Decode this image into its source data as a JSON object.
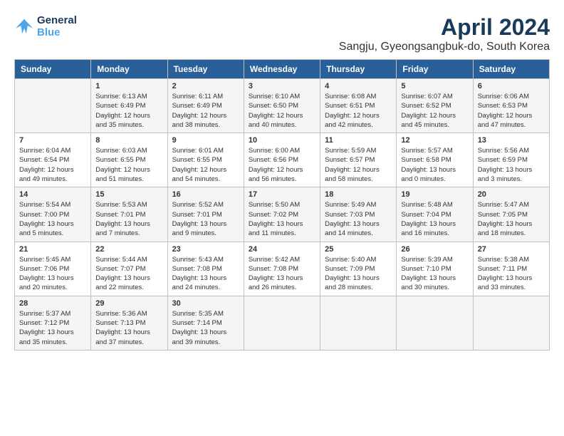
{
  "logo": {
    "line1": "General",
    "line2": "Blue"
  },
  "title": "April 2024",
  "subtitle": "Sangju, Gyeongsangbuk-do, South Korea",
  "headers": [
    "Sunday",
    "Monday",
    "Tuesday",
    "Wednesday",
    "Thursday",
    "Friday",
    "Saturday"
  ],
  "weeks": [
    [
      {
        "day": "",
        "info": ""
      },
      {
        "day": "1",
        "info": "Sunrise: 6:13 AM\nSunset: 6:49 PM\nDaylight: 12 hours\nand 35 minutes."
      },
      {
        "day": "2",
        "info": "Sunrise: 6:11 AM\nSunset: 6:49 PM\nDaylight: 12 hours\nand 38 minutes."
      },
      {
        "day": "3",
        "info": "Sunrise: 6:10 AM\nSunset: 6:50 PM\nDaylight: 12 hours\nand 40 minutes."
      },
      {
        "day": "4",
        "info": "Sunrise: 6:08 AM\nSunset: 6:51 PM\nDaylight: 12 hours\nand 42 minutes."
      },
      {
        "day": "5",
        "info": "Sunrise: 6:07 AM\nSunset: 6:52 PM\nDaylight: 12 hours\nand 45 minutes."
      },
      {
        "day": "6",
        "info": "Sunrise: 6:06 AM\nSunset: 6:53 PM\nDaylight: 12 hours\nand 47 minutes."
      }
    ],
    [
      {
        "day": "7",
        "info": "Sunrise: 6:04 AM\nSunset: 6:54 PM\nDaylight: 12 hours\nand 49 minutes."
      },
      {
        "day": "8",
        "info": "Sunrise: 6:03 AM\nSunset: 6:55 PM\nDaylight: 12 hours\nand 51 minutes."
      },
      {
        "day": "9",
        "info": "Sunrise: 6:01 AM\nSunset: 6:55 PM\nDaylight: 12 hours\nand 54 minutes."
      },
      {
        "day": "10",
        "info": "Sunrise: 6:00 AM\nSunset: 6:56 PM\nDaylight: 12 hours\nand 56 minutes."
      },
      {
        "day": "11",
        "info": "Sunrise: 5:59 AM\nSunset: 6:57 PM\nDaylight: 12 hours\nand 58 minutes."
      },
      {
        "day": "12",
        "info": "Sunrise: 5:57 AM\nSunset: 6:58 PM\nDaylight: 13 hours\nand 0 minutes."
      },
      {
        "day": "13",
        "info": "Sunrise: 5:56 AM\nSunset: 6:59 PM\nDaylight: 13 hours\nand 3 minutes."
      }
    ],
    [
      {
        "day": "14",
        "info": "Sunrise: 5:54 AM\nSunset: 7:00 PM\nDaylight: 13 hours\nand 5 minutes."
      },
      {
        "day": "15",
        "info": "Sunrise: 5:53 AM\nSunset: 7:01 PM\nDaylight: 13 hours\nand 7 minutes."
      },
      {
        "day": "16",
        "info": "Sunrise: 5:52 AM\nSunset: 7:01 PM\nDaylight: 13 hours\nand 9 minutes."
      },
      {
        "day": "17",
        "info": "Sunrise: 5:50 AM\nSunset: 7:02 PM\nDaylight: 13 hours\nand 11 minutes."
      },
      {
        "day": "18",
        "info": "Sunrise: 5:49 AM\nSunset: 7:03 PM\nDaylight: 13 hours\nand 14 minutes."
      },
      {
        "day": "19",
        "info": "Sunrise: 5:48 AM\nSunset: 7:04 PM\nDaylight: 13 hours\nand 16 minutes."
      },
      {
        "day": "20",
        "info": "Sunrise: 5:47 AM\nSunset: 7:05 PM\nDaylight: 13 hours\nand 18 minutes."
      }
    ],
    [
      {
        "day": "21",
        "info": "Sunrise: 5:45 AM\nSunset: 7:06 PM\nDaylight: 13 hours\nand 20 minutes."
      },
      {
        "day": "22",
        "info": "Sunrise: 5:44 AM\nSunset: 7:07 PM\nDaylight: 13 hours\nand 22 minutes."
      },
      {
        "day": "23",
        "info": "Sunrise: 5:43 AM\nSunset: 7:08 PM\nDaylight: 13 hours\nand 24 minutes."
      },
      {
        "day": "24",
        "info": "Sunrise: 5:42 AM\nSunset: 7:08 PM\nDaylight: 13 hours\nand 26 minutes."
      },
      {
        "day": "25",
        "info": "Sunrise: 5:40 AM\nSunset: 7:09 PM\nDaylight: 13 hours\nand 28 minutes."
      },
      {
        "day": "26",
        "info": "Sunrise: 5:39 AM\nSunset: 7:10 PM\nDaylight: 13 hours\nand 30 minutes."
      },
      {
        "day": "27",
        "info": "Sunrise: 5:38 AM\nSunset: 7:11 PM\nDaylight: 13 hours\nand 33 minutes."
      }
    ],
    [
      {
        "day": "28",
        "info": "Sunrise: 5:37 AM\nSunset: 7:12 PM\nDaylight: 13 hours\nand 35 minutes."
      },
      {
        "day": "29",
        "info": "Sunrise: 5:36 AM\nSunset: 7:13 PM\nDaylight: 13 hours\nand 37 minutes."
      },
      {
        "day": "30",
        "info": "Sunrise: 5:35 AM\nSunset: 7:14 PM\nDaylight: 13 hours\nand 39 minutes."
      },
      {
        "day": "",
        "info": ""
      },
      {
        "day": "",
        "info": ""
      },
      {
        "day": "",
        "info": ""
      },
      {
        "day": "",
        "info": ""
      }
    ]
  ]
}
